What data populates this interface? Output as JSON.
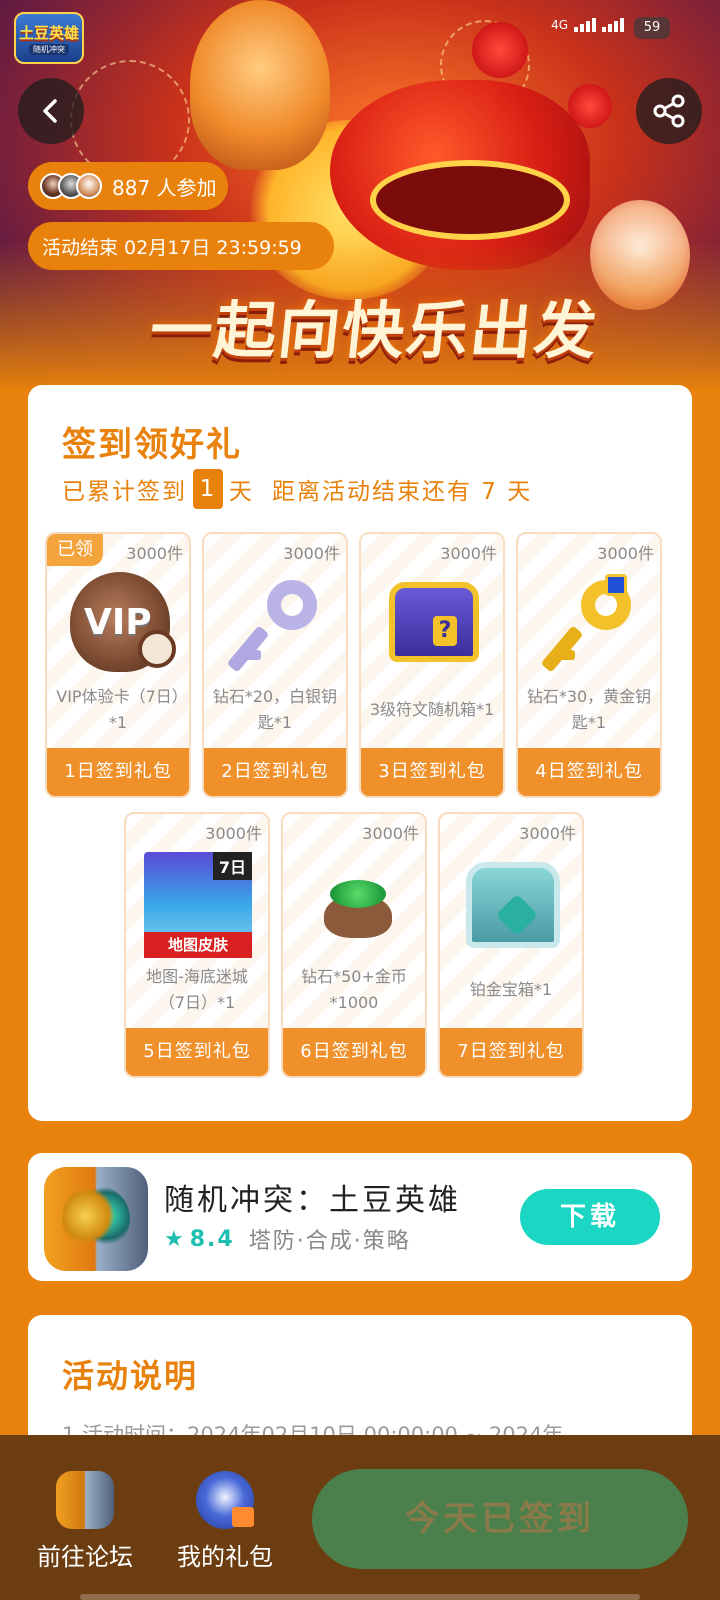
{
  "status_bar": {
    "network": "4G",
    "battery": "59"
  },
  "banner": {
    "logo_main": "土豆英雄",
    "logo_sub": "随机冲突",
    "title": "一起向快乐出发"
  },
  "participants": {
    "count_text": "887 人参加"
  },
  "deadline": {
    "text": "活动结束 02月17日 23:59:59"
  },
  "signin": {
    "title": "签到领好礼",
    "progress_prefix": "已累计签到",
    "days_signed": "1",
    "progress_day_unit": "天",
    "remaining_text": "距离活动结束还有 7 天",
    "claimed_tag": "已领",
    "gifts": [
      {
        "qty": "3000件",
        "desc": "VIP体验卡（7日）*1",
        "button": "1日签到礼包",
        "icon": "vip-card-icon",
        "claimed": true
      },
      {
        "qty": "3000件",
        "desc": "钻石*20，白银钥匙*1",
        "button": "2日签到礼包",
        "icon": "silver-key-icon",
        "claimed": false
      },
      {
        "qty": "3000件",
        "desc": "3级符文随机箱*1",
        "button": "3日签到礼包",
        "icon": "rune-chest-icon",
        "claimed": false
      },
      {
        "qty": "3000件",
        "desc": "钻石*30，黄金钥匙*1",
        "button": "4日签到礼包",
        "icon": "gold-key-icon",
        "claimed": false
      },
      {
        "qty": "3000件",
        "desc": "地图-海底迷城（7日）*1",
        "button": "5日签到礼包",
        "icon": "map-skin-icon",
        "claimed": false,
        "img_tag": "7日",
        "img_band": "地图皮肤"
      },
      {
        "qty": "3000件",
        "desc": "钻石*50+金币*1000",
        "button": "6日签到礼包",
        "icon": "gem-bag-icon",
        "claimed": false
      },
      {
        "qty": "3000件",
        "desc": "铂金宝箱*1",
        "button": "7日签到礼包",
        "icon": "platinum-chest-icon",
        "claimed": false
      }
    ]
  },
  "app": {
    "name": "随机冲突：土豆英雄",
    "rating": "8.4",
    "tags": "塔防·合成·策略",
    "download_label": "下载"
  },
  "rules": {
    "title": "活动说明",
    "line1": "1.活动时间：2024年02月10日 00:00:00 ~ 2024年"
  },
  "bottom": {
    "forum_label": "前往论坛",
    "gifts_label": "我的礼包",
    "signed_label": "今天已签到"
  },
  "colors": {
    "accent": "#e8820c",
    "download": "#1ad6c2",
    "signed_button": "#4b7f4c",
    "bottom_bar": "#6b3d10"
  }
}
